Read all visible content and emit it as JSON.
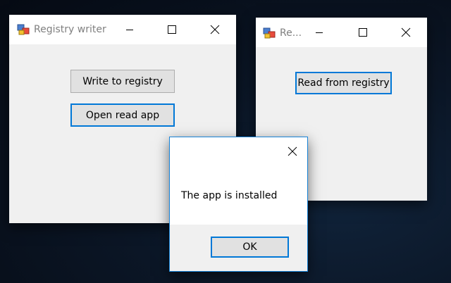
{
  "writer_window": {
    "title": "Registry writer",
    "write_button": "Write to registry",
    "open_button": "Open read app"
  },
  "reader_window": {
    "title": "Re...",
    "read_button": "Read from registry"
  },
  "message_box": {
    "message": "The app is installed",
    "ok_button": "OK"
  },
  "icons": {
    "app": "registry-app-icon",
    "minimize": "minimize-icon",
    "maximize": "maximize-icon",
    "close": "close-icon"
  },
  "colors": {
    "focus_border": "#0078d7",
    "button_face": "#e1e1e1",
    "window_face": "#f0f0f0",
    "title_text": "#808080"
  }
}
